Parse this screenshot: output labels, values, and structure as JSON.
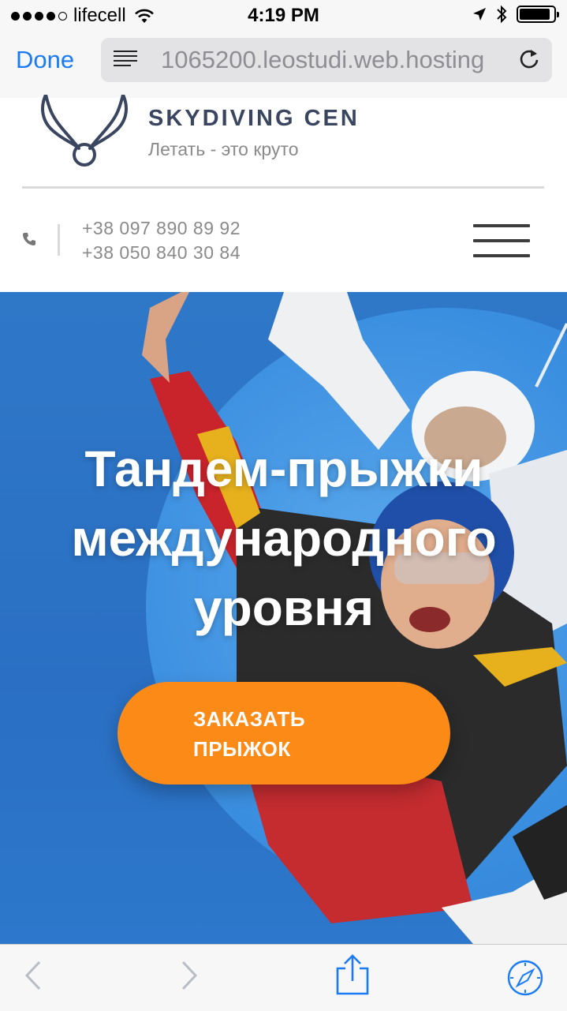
{
  "status_bar": {
    "carrier": "lifecell",
    "time": "4:19 PM",
    "signal_bars_filled": 4,
    "signal_bars_total": 5,
    "battery_level": 0.9
  },
  "browser": {
    "done_label": "Done",
    "url": "1065200.leostudi.web.hosting"
  },
  "header": {
    "brand_name": "SKYDIVING CEN",
    "tagline": "Летать - это круто",
    "phones": [
      "+38 097 890 89 92",
      "+38 050 840 30 84"
    ]
  },
  "hero": {
    "title": "Тандем-прыжки международного уровня",
    "cta_label": "ЗАКАЗАТЬ\nПРЫЖОК"
  },
  "icons": {
    "reader": "reader-mode-icon",
    "reload": "reload-icon",
    "menu": "hamburger-menu-icon",
    "phone": "phone-icon",
    "back": "back-arrow-icon",
    "forward": "forward-arrow-icon",
    "share": "share-icon",
    "safari": "compass-icon"
  },
  "colors": {
    "accent": "#fb8a17",
    "link": "#1a7cf5",
    "brand": "#3a4560",
    "hero_bg": "#2f78c8"
  }
}
